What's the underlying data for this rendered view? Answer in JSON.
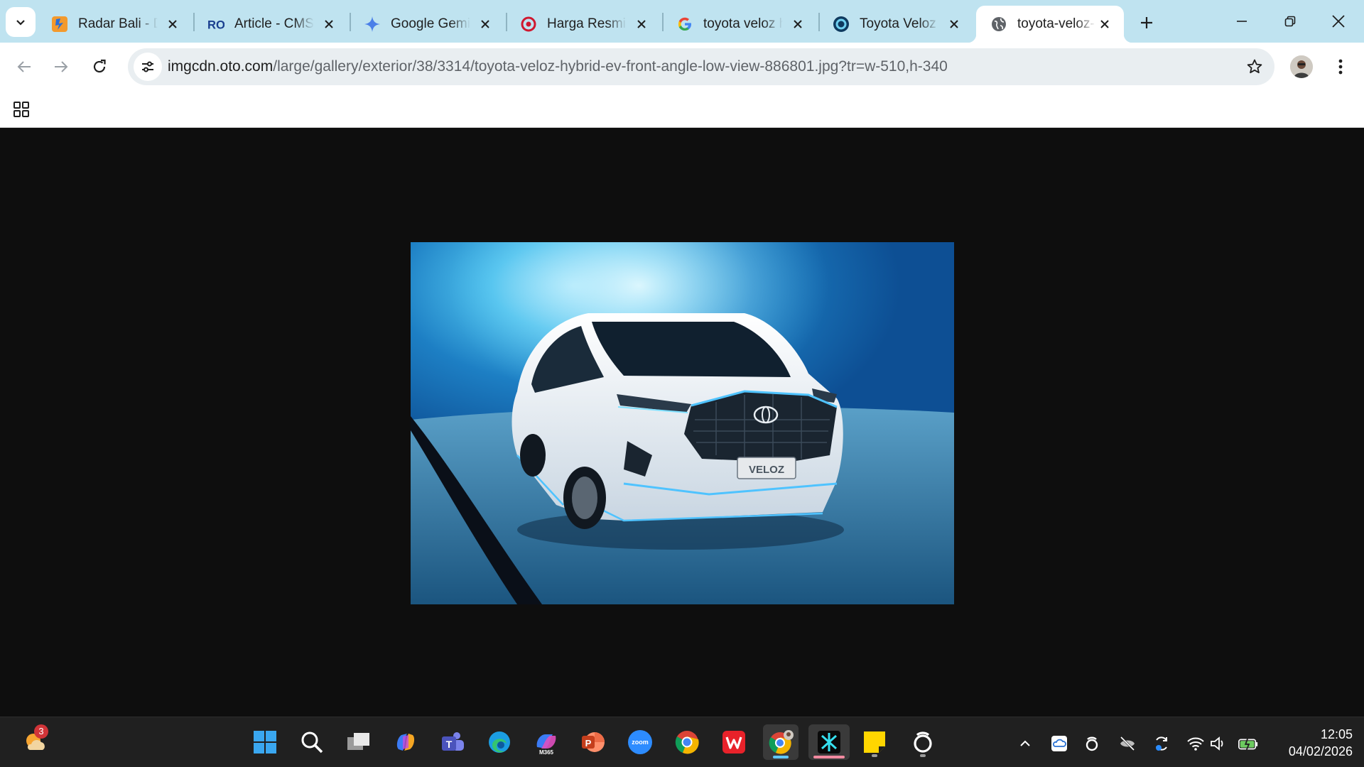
{
  "browser": {
    "tabs": [
      {
        "title": "Radar Bali - Da",
        "favicon": "radar-bali-icon",
        "active": false
      },
      {
        "title": "Article - CMS R",
        "favicon": "cms-icon",
        "active": false
      },
      {
        "title": "Google Gemini",
        "favicon": "gemini-icon",
        "active": false
      },
      {
        "title": "Harga Resmi V",
        "favicon": "red-logo-icon",
        "active": false
      },
      {
        "title": "toyota veloz h",
        "favicon": "google-icon",
        "active": false
      },
      {
        "title": "Toyota Veloz H",
        "favicon": "oto-icon",
        "active": false
      },
      {
        "title": "toyota-veloz-h",
        "favicon": "globe-icon",
        "active": true
      }
    ],
    "address_bar": {
      "host": "imgcdn.oto.com",
      "path": "/large/gallery/exterior/38/3314/toyota-veloz-hybrid-ev-front-angle-low-view-886801.jpg?tr=w-510,h-340"
    }
  },
  "content": {
    "image": {
      "plate_text": "VELOZ",
      "alt_subject": "toyota-veloz-hybrid-ev-front-angle-low-view"
    }
  },
  "taskbar": {
    "weather_badge": "3",
    "apps": [
      {
        "name": "start-icon"
      },
      {
        "name": "search-icon"
      },
      {
        "name": "task-view-icon"
      },
      {
        "name": "copilot-icon"
      },
      {
        "name": "teams-icon"
      },
      {
        "name": "edge-icon"
      },
      {
        "name": "m365-icon",
        "label": "M365"
      },
      {
        "name": "powerpoint-icon"
      },
      {
        "name": "zoom-icon",
        "label": "zoom"
      },
      {
        "name": "chrome-icon"
      },
      {
        "name": "wps-icon"
      },
      {
        "name": "chrome-profile-icon"
      },
      {
        "name": "capcut-icon"
      },
      {
        "name": "sticky-notes-icon"
      },
      {
        "name": "copilot-app-icon"
      }
    ],
    "clock": {
      "time": "12:05",
      "date": "04/02/2026"
    }
  },
  "colors": {
    "tabstrip": "#bfe3f0",
    "toolbar": "#ffffff",
    "omnibox": "#e9eef1",
    "page_bg": "#0e0e0e",
    "taskbar": "#202020"
  }
}
